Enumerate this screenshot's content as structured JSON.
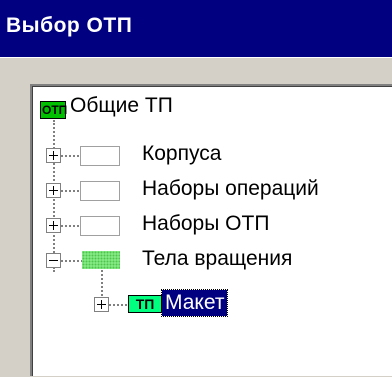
{
  "window": {
    "title": "Выбор ОТП"
  },
  "tree": {
    "root": {
      "icon_text": "ОТП",
      "label": "Общие ТП"
    },
    "items": [
      {
        "label": "Корпуса",
        "expander": "plus"
      },
      {
        "label": "Наборы операций",
        "expander": "plus"
      },
      {
        "label": "Наборы ОТП",
        "expander": "plus"
      },
      {
        "label": "Тела вращения",
        "expander": "minus"
      }
    ],
    "child": {
      "icon_text": "ТП",
      "label": "Макет",
      "selected": true
    }
  }
}
